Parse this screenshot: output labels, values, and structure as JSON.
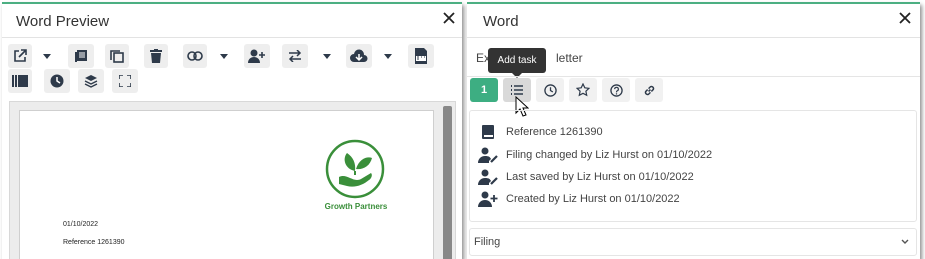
{
  "left": {
    "title": "Word Preview",
    "toolbar_icons": [
      "external-link-icon",
      "caret-down-icon",
      "document-stack-icon",
      "copy-icon",
      "trash-icon",
      "link-icon",
      "caret-down-icon",
      "user-add-icon",
      "exchange-icon",
      "caret-down-icon",
      "cloud-download-icon",
      "caret-down-icon",
      "pdf-icon",
      "gallery-icon",
      "clock-icon",
      "layers-icon",
      "fullscreen-icon"
    ],
    "preview": {
      "company_name": "Growth Partners",
      "date": "01/10/2022",
      "reference": "Reference 1261390",
      "brand_color": "#3a8f3a"
    }
  },
  "right": {
    "title": "Word",
    "doc_name_part1": "Ex",
    "doc_name_part2": "letter",
    "tooltip": "Add task",
    "tabs": [
      {
        "label": "1",
        "icon": "count-badge"
      },
      {
        "label": "",
        "icon": "task-list-icon"
      },
      {
        "label": "",
        "icon": "clock-icon"
      },
      {
        "label": "",
        "icon": "star-icon"
      },
      {
        "label": "",
        "icon": "help-icon"
      },
      {
        "label": "",
        "icon": "link-icon"
      }
    ],
    "info": [
      {
        "icon": "book-icon",
        "text": "Reference 1261390"
      },
      {
        "icon": "user-edit-icon",
        "text": "Filing changed by Liz Hurst on 01/10/2022"
      },
      {
        "icon": "user-edit-icon",
        "text": "Last saved by Liz Hurst on 01/10/2022"
      },
      {
        "icon": "user-add-icon",
        "text": "Created by Liz Hurst on 01/10/2022"
      }
    ],
    "filing_label": "Filing"
  },
  "colors": {
    "accent": "#3dae82",
    "icon": "#2e3a4a",
    "header_border": "#4caf82"
  }
}
